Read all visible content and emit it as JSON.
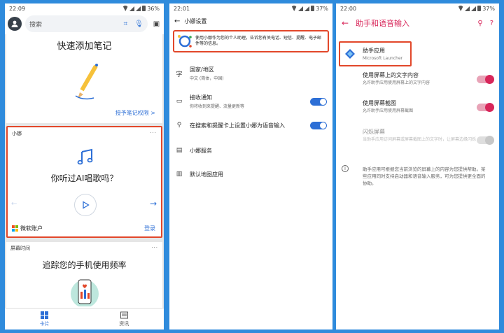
{
  "phone1": {
    "status": {
      "time": "22:09",
      "battery": "36%"
    },
    "search_placeholder": "搜索",
    "notes_card": {
      "title": "快速添加笔记",
      "link": "授予笔记权限 >"
    },
    "xiaona_card": {
      "label": "小娜",
      "more": "···",
      "question": "你听过AI唱歌吗？",
      "ms_account": "微软账户",
      "login": "登录"
    },
    "screen_card": {
      "label": "屏幕时间",
      "more": "···",
      "title": "追踪您的手机使用频率"
    },
    "nav": [
      {
        "label": "卡片"
      },
      {
        "label": "资讯"
      }
    ]
  },
  "phone2": {
    "status": {
      "time": "22:01",
      "battery": "37%"
    },
    "title": "小娜设置",
    "banner": "使用小娜作为您的个人助理，告诉您有关电话、短信、提醒、电子邮件等的信息。",
    "items": [
      {
        "icon": "字",
        "title": "国家/地区",
        "sub": "中文 (简体，中国)"
      },
      {
        "icon": "▭",
        "title": "接收通知",
        "sub": "你将收到来提醒、流量更新等"
      },
      {
        "icon": "⚲",
        "title": "在搜索和提醒卡上设置小娜为语音输入",
        "sub": ""
      },
      {
        "icon": "▤",
        "title": "小娜服务",
        "sub": ""
      },
      {
        "icon": "▥",
        "title": "默认地图应用",
        "sub": ""
      }
    ]
  },
  "phone3": {
    "status": {
      "time": "22:00",
      "battery": "37%"
    },
    "title": "助手和语音输入",
    "assist": {
      "title": "助手应用",
      "sub": "Microsoft Launcher"
    },
    "rows": [
      {
        "title": "使用屏幕上的文字内容",
        "sub": "允许助手应用使用屏幕上的文字内容"
      },
      {
        "title": "使用屏幕截图",
        "sub": "允许助手应用使用屏幕截图"
      },
      {
        "title": "闪烁屏幕",
        "sub": "当助手应用访问屏幕或屏幕截图上的文字时，让屏幕边缘闪烁"
      }
    ],
    "info": "助手应用可根据您当前浏览的屏幕上的内容为您提供帮助。某些应用同时支持启动器和语音输入服务，可为您提供更全面的协助。"
  },
  "colors": {
    "background": "#2f8bdc",
    "highlight": "#e2472a",
    "accent_blue": "#2d6fd6",
    "accent_pink": "#d8265a"
  }
}
